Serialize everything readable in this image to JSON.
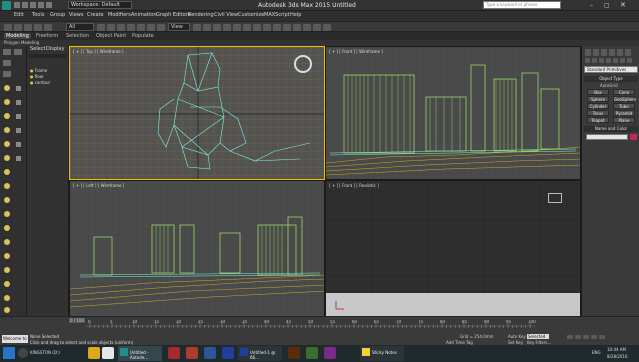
{
  "window": {
    "title": "Autodesk 3ds Max  2015    Untitled",
    "workspace": "Workspace: Default",
    "search_placeholder": "Type a keyword or phrase"
  },
  "menu": [
    "Edit",
    "Tools",
    "Group",
    "Views",
    "Create",
    "Modifiers",
    "Animation",
    "Graph Editors",
    "Rendering",
    "Civil View",
    "Customize",
    "MAXScript",
    "Help"
  ],
  "toolbar": {
    "selection_filter": "All",
    "view_dropdown": "View"
  },
  "ribbon": {
    "tabs": [
      "Modeling",
      "Freeform",
      "Selection",
      "Object Paint",
      "Populate"
    ],
    "active_tab": "Modeling",
    "sub_label": "Polygon Modeling"
  },
  "explorer": {
    "tabs": [
      "Select",
      "Display"
    ],
    "items": [
      "Frame",
      "floor",
      "contour"
    ]
  },
  "viewports": {
    "top_label": "[ + ] [ Top ] [ Wireframe ]",
    "front_label": "[ + ] [ Front ] [ Wireframe ]",
    "left_label": "[ + ] [ Left ] [ Wireframe ]",
    "persp_label": "[ + ] [ Front ] [ Realistic ]"
  },
  "command_panel": {
    "category": "Standard Primitives",
    "rollout_title": "Object Type",
    "autogrid": "AutoGrid",
    "primitives": [
      "Box",
      "Cone",
      "Sphere",
      "GeoSphere",
      "Cylinder",
      "Tube",
      "Torus",
      "Pyramid",
      "Teapot",
      "Plane"
    ],
    "name_color_title": "Name and Color"
  },
  "timeline": {
    "frame_counter": "0 / 100",
    "ticks": [
      "0",
      "5",
      "10",
      "15",
      "20",
      "25",
      "30",
      "35",
      "40",
      "45",
      "50",
      "55",
      "60",
      "65",
      "70",
      "75",
      "80",
      "85",
      "90",
      "95",
      "100"
    ]
  },
  "status": {
    "selection": "None Selected",
    "prompt": "Click and drag to select and scale objects (uniform)",
    "welcome": "Welcome to M",
    "grid": "Grid = 254.0mm",
    "add_time_tag": "Add Time Tag",
    "auto_key": "Auto Key",
    "set_key": "Set Key",
    "selected": "Selected",
    "key_filters": "Key Filters..."
  },
  "taskbar": {
    "drive": "KINGSTON (D:)",
    "apps": [
      "Untitled - Autode...",
      "Untitled-1 @ 66...",
      "Sticky Notes"
    ],
    "locale": "ENG",
    "time": "10:44 AM",
    "date": "8/28/2016"
  },
  "colors": {
    "wire_cyan": "#7ff0d8",
    "wire_yellow": "#e8c61c",
    "wire_green": "#a6e86a",
    "accent_blue": "#3a6ea5"
  }
}
